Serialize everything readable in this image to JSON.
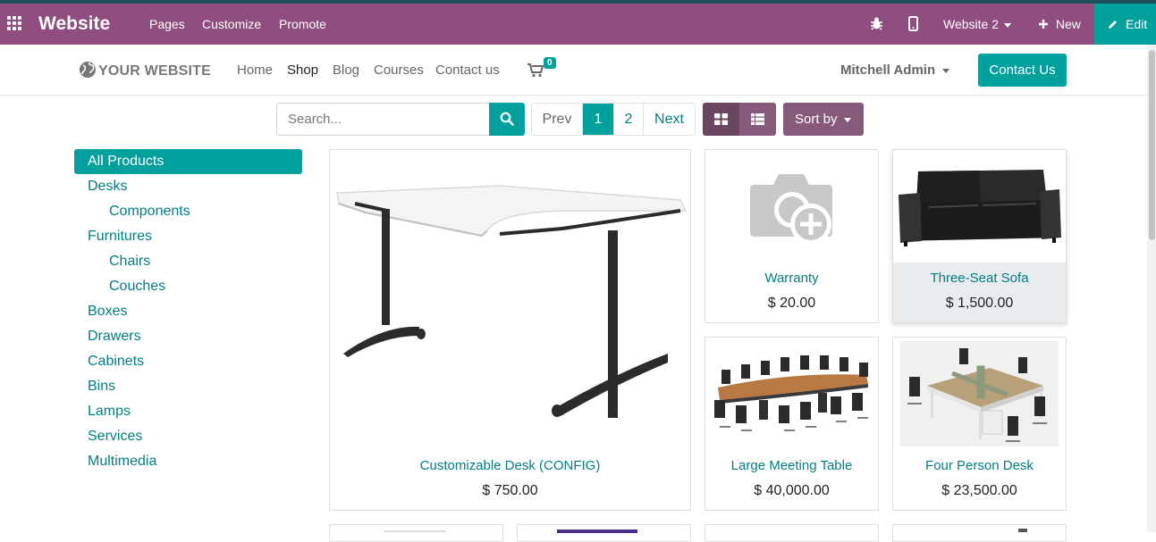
{
  "admin_bar": {
    "title": "Website",
    "menu": [
      "Pages",
      "Customize",
      "Promote"
    ],
    "website_selector": "Website 2",
    "new_label": "New",
    "edit_label": "Edit",
    "colors": {
      "bar": "#8f4e7f",
      "edit": "#00a09d"
    }
  },
  "site_header": {
    "logo_text": "YOUR WEBSITE",
    "nav": [
      "Home",
      "Shop",
      "Blog",
      "Courses",
      "Contact us"
    ],
    "active_nav": "Shop",
    "cart_count": "0",
    "user": "Mitchell Admin",
    "contact_button": "Contact Us"
  },
  "toolbar": {
    "search_placeholder": "Search...",
    "pager": {
      "prev": "Prev",
      "pages": [
        "1",
        "2"
      ],
      "current": "1",
      "next": "Next"
    },
    "sort_label": "Sort by"
  },
  "categories": [
    {
      "label": "All Products",
      "active": true
    },
    {
      "label": "Desks"
    },
    {
      "label": "Components",
      "sub": true
    },
    {
      "label": "Furnitures"
    },
    {
      "label": "Chairs",
      "sub": true
    },
    {
      "label": "Couches",
      "sub": true
    },
    {
      "label": "Boxes"
    },
    {
      "label": "Drawers"
    },
    {
      "label": "Cabinets"
    },
    {
      "label": "Bins"
    },
    {
      "label": "Lamps"
    },
    {
      "label": "Services"
    },
    {
      "label": "Multimedia"
    }
  ],
  "products": [
    {
      "name": "Customizable Desk (CONFIG)",
      "price": "$ 750.00",
      "image": "desk-image"
    },
    {
      "name": "Warranty",
      "price": "$ 20.00",
      "image": "placeholder-camera-icon"
    },
    {
      "name": "Three-Seat Sofa",
      "price": "$ 1,500.00",
      "image": "sofa-image"
    },
    {
      "name": "Large Meeting Table",
      "price": "$ 40,000.00",
      "image": "meeting-table-image"
    },
    {
      "name": "Four Person Desk",
      "price": "$ 23,500.00",
      "image": "four-person-desk-image"
    }
  ],
  "accent_color": "#00a09d",
  "link_color": "#017e84"
}
